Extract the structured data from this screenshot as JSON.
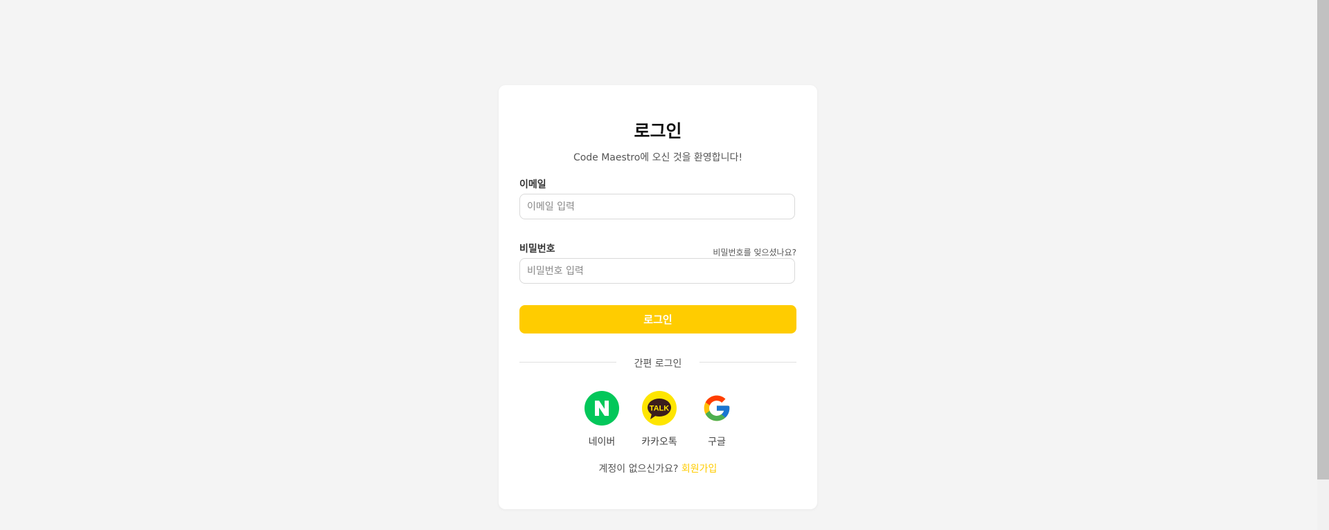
{
  "login": {
    "title": "로그인",
    "subtitle": "Code Maestro에 오신 것을 환영합니다!",
    "email_label": "이메일",
    "email_placeholder": "이메일 입력",
    "email_value": "",
    "password_label": "비밀번호",
    "password_placeholder": "비밀번호 입력",
    "password_value": "",
    "forgot_password": "비밀번호를 잊으셨나요?",
    "submit_label": "로그인",
    "divider": "간편 로그인",
    "social": [
      {
        "name": "네이버",
        "icon": "naver-icon",
        "color": "#03c75a"
      },
      {
        "name": "카카오톡",
        "icon": "kakao-talk-icon",
        "color": "#fee500"
      },
      {
        "name": "구글",
        "icon": "google-icon",
        "color": "#4285f4"
      }
    ],
    "signup_prompt": "계정이 없으신가요?",
    "signup_link": "회원가입"
  },
  "colors": {
    "accent": "#ffcc00",
    "background": "#f4f4f4",
    "card": "#ffffff"
  }
}
